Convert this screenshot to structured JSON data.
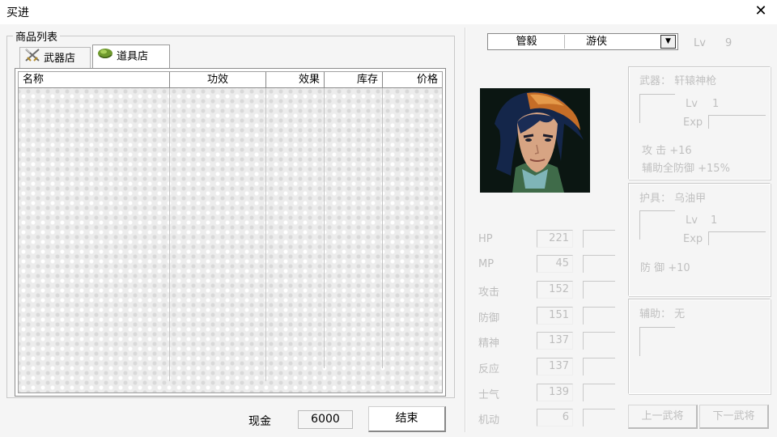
{
  "window": {
    "title": "买进",
    "close_icon": "close-icon"
  },
  "product_list": {
    "group_label": "商品列表",
    "tabs": [
      {
        "label": "武器店",
        "icon": "crossed-swords-icon",
        "selected": false
      },
      {
        "label": "道具店",
        "icon": "herb-pouch-icon",
        "selected": true
      }
    ],
    "columns": [
      "名称",
      "功效",
      "效果",
      "库存",
      "价格"
    ],
    "rows": []
  },
  "footer": {
    "cash_label": "现金",
    "cash_value": "6000",
    "end_button": "结束"
  },
  "general": {
    "name": "管毅",
    "class": "游侠",
    "lv_label": "Lv",
    "lv_value": "9",
    "portrait_icon": "hero-portrait-icon"
  },
  "stats": [
    {
      "label": "HP",
      "value": "221"
    },
    {
      "label": "MP",
      "value": "45"
    },
    {
      "label": "攻击",
      "value": "152"
    },
    {
      "label": "防御",
      "value": "151"
    },
    {
      "label": "精神",
      "value": "137"
    },
    {
      "label": "反应",
      "value": "137"
    },
    {
      "label": "士气",
      "value": "139"
    },
    {
      "label": "机动",
      "value": "6"
    }
  ],
  "weapon": {
    "title": "武器：  轩辕神枪",
    "lv_label": "Lv",
    "lv_value": "1",
    "exp_label": "Exp",
    "effect1": "攻  击  +16",
    "effect2": "辅助全防御  +15%"
  },
  "armor": {
    "title": "护具：  乌油甲",
    "lv_label": "Lv",
    "lv_value": "1",
    "exp_label": "Exp",
    "effect1": "防  御  +10"
  },
  "accessory": {
    "title": "辅助：  无"
  },
  "nav": {
    "prev": "上一武将",
    "next": "下一武将"
  }
}
